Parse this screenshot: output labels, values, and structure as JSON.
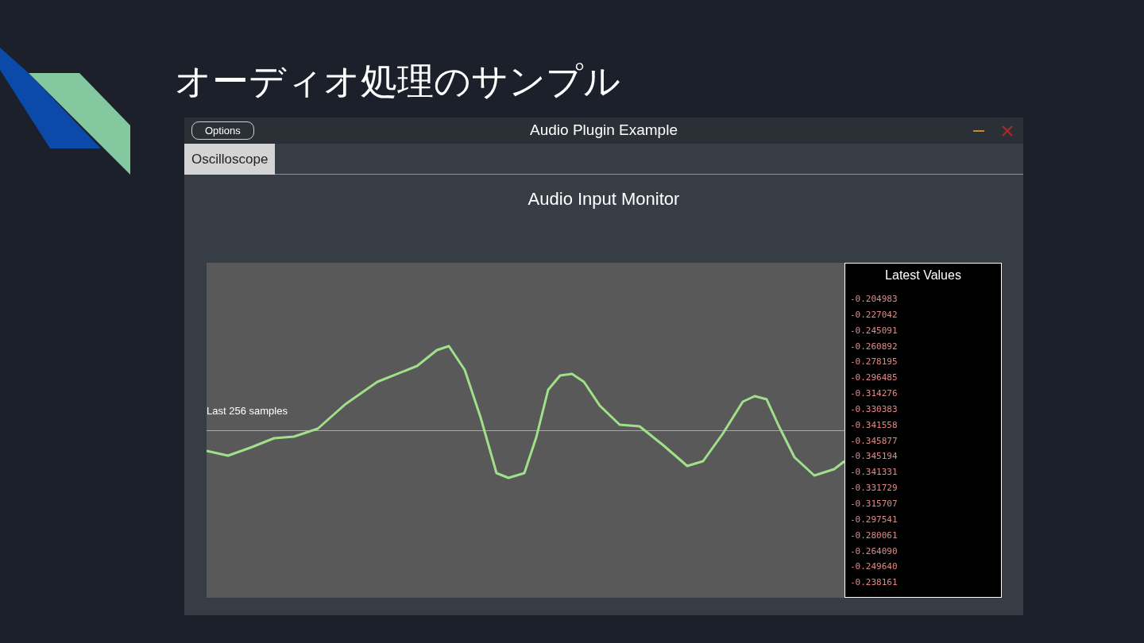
{
  "slide_title": "オーディオ処理のサンプル",
  "window": {
    "title": "Audio Plugin Example",
    "options_button": "Options"
  },
  "tabs": [
    {
      "label": "Oscilloscope",
      "selected": true
    }
  ],
  "panel_title": "Audio Input Monitor",
  "scope": {
    "label": "Last 256 samples"
  },
  "latest_values": {
    "title": "Latest Values",
    "values": [
      "-0.204983",
      "-0.227042",
      "-0.245091",
      "-0.260892",
      "-0.278195",
      "-0.296485",
      "-0.314276",
      "-0.330383",
      "-0.341558",
      "-0.345877",
      "-0.345194",
      "-0.341331",
      "-0.331729",
      "-0.315707",
      "-0.297541",
      "-0.280061",
      "-0.264090",
      "-0.249640",
      "-0.238161"
    ]
  }
}
